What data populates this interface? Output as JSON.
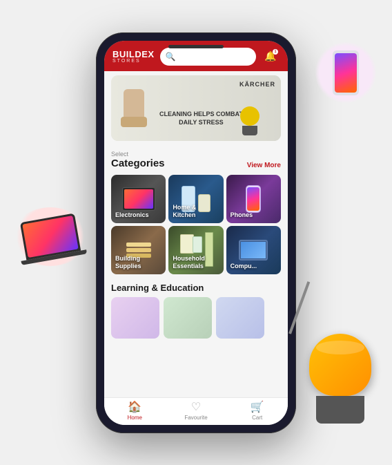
{
  "app": {
    "name": "BUILDEX",
    "subtitle": "STORES"
  },
  "header": {
    "search_placeholder": "Search...",
    "notification_count": "1"
  },
  "banner": {
    "brand": "KÄRCHER",
    "line1": "CLEANING HELPS COMBAT",
    "line2": "DAILY STRESS"
  },
  "categories": {
    "label": "Select",
    "title": "Categories",
    "view_more": "View More",
    "items": [
      {
        "id": "electronics",
        "label": "Electronics"
      },
      {
        "id": "home-kitchen",
        "label": "Home &\nKitchen"
      },
      {
        "id": "phones",
        "label": "Phones"
      },
      {
        "id": "building",
        "label": "Building\nSupplies"
      },
      {
        "id": "household",
        "label": "Household\nEssentials"
      },
      {
        "id": "computers",
        "label": "Compu..."
      }
    ]
  },
  "learning": {
    "title": "Learning & Education"
  },
  "nav": {
    "items": [
      {
        "id": "home",
        "label": "Home",
        "icon": "🏠",
        "active": true
      },
      {
        "id": "favourite",
        "label": "Favourite",
        "icon": "♡",
        "active": false
      },
      {
        "id": "cart",
        "label": "Cart",
        "icon": "🛒",
        "active": false
      }
    ]
  }
}
